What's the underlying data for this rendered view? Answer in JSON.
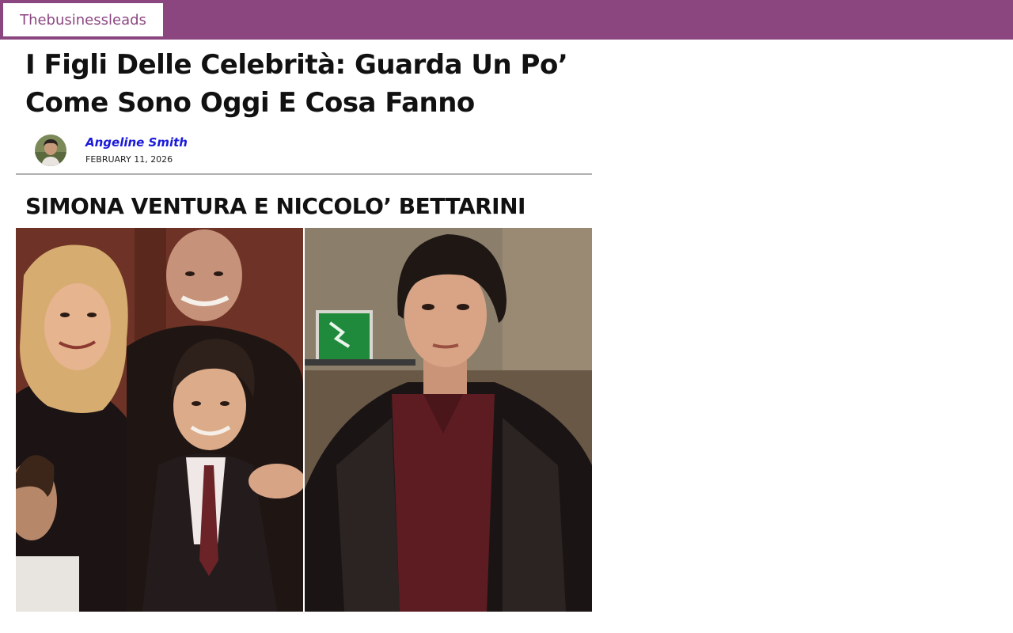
{
  "header": {
    "site_name": "Thebusinessleads",
    "bar_color": "#8b4680"
  },
  "article": {
    "title": "I Figli Delle Celebrità: Guarda Un Po’ Come Sono Oggi E Cosa Fanno",
    "author": "Angeline Smith",
    "author_color": "#1a1adb",
    "date": "FEBRUARY 11, 2026",
    "section_heading": "SIMONA VENTURA E NICCOLO’ BETTARINI"
  },
  "images": {
    "left": "family-photo",
    "right": "young-man-photo"
  }
}
